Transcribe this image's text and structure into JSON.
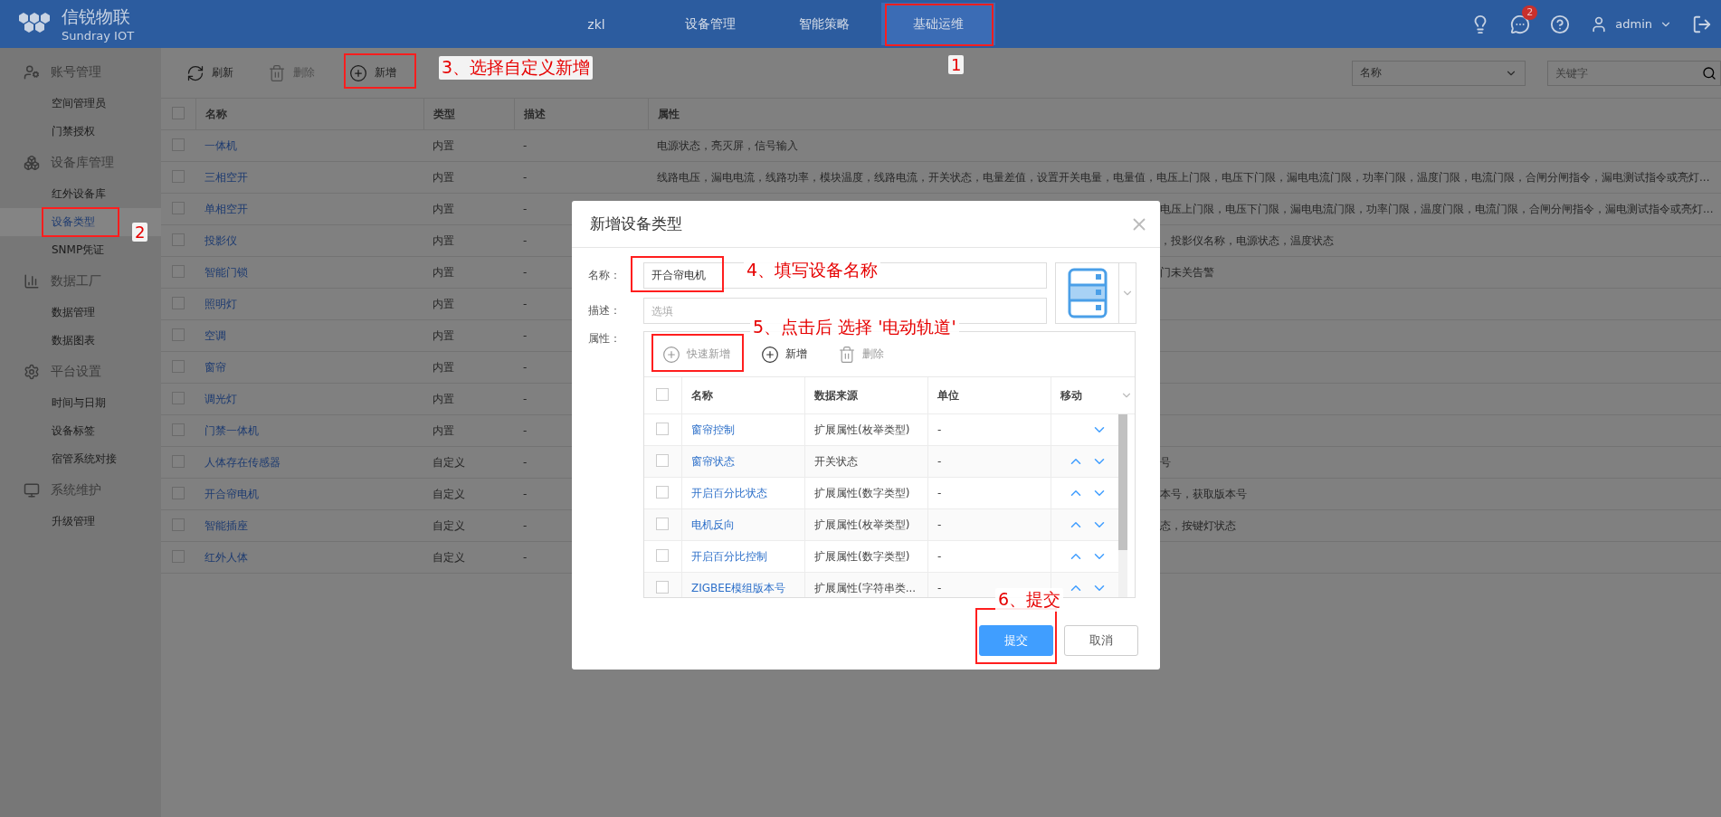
{
  "header": {
    "logo_title": "信锐物联",
    "logo_subtitle": "Sundray IOT",
    "notification_count": "2",
    "user": "admin",
    "nav": [
      {
        "label": "zkl",
        "selected": false
      },
      {
        "label": "设备管理",
        "selected": false
      },
      {
        "label": "智能策略",
        "selected": false
      },
      {
        "label": "基础运维",
        "selected": true
      }
    ]
  },
  "sidebar": {
    "groups": [
      {
        "title": "账号管理",
        "items": [
          {
            "label": "空间管理员",
            "selected": false
          },
          {
            "label": "门禁授权",
            "selected": false
          }
        ]
      },
      {
        "title": "设备库管理",
        "items": [
          {
            "label": "红外设备库",
            "selected": false
          },
          {
            "label": "设备类型",
            "selected": true
          },
          {
            "label": "SNMP凭证",
            "selected": false
          }
        ]
      },
      {
        "title": "数据工厂",
        "items": [
          {
            "label": "数据管理",
            "selected": false
          },
          {
            "label": "数据图表",
            "selected": false
          }
        ]
      },
      {
        "title": "平台设置",
        "items": [
          {
            "label": "时间与日期",
            "selected": false
          },
          {
            "label": "设备标签",
            "selected": false
          },
          {
            "label": "宿管系统对接",
            "selected": false
          }
        ]
      },
      {
        "title": "系统维护",
        "items": [
          {
            "label": "升级管理",
            "selected": false
          }
        ]
      }
    ]
  },
  "toolbar": {
    "buttons": [
      {
        "label": "刷新",
        "kind": "refresh",
        "disabled": false
      },
      {
        "label": "删除",
        "kind": "delete",
        "disabled": true
      },
      {
        "label": "新增",
        "kind": "add",
        "disabled": false
      }
    ],
    "filter_select": "名称",
    "search": {
      "placeholder": "关键字"
    }
  },
  "table": {
    "columns": [
      "名称",
      "类型",
      "描述",
      "属性"
    ],
    "all_checked": false,
    "rows": [
      {
        "checked": false,
        "name": "一体机",
        "type": "内置",
        "description": "-",
        "attributes": "电源状态，亮灭屏，信号输入"
      },
      {
        "checked": false,
        "name": "三相空开",
        "type": "内置",
        "description": "-",
        "attributes": "线路电压，漏电电流，线路功率，模块温度，线路电流，开关状态，电量差值，设置开关电量，电量值，电压上门限，电压下门限，漏电电流门限，功率门限，温度门限，电流门限，合闸分闸指令，漏电测试指令或亮灯..."
      },
      {
        "checked": false,
        "name": "单相空开",
        "type": "内置",
        "description": "-",
        "attributes": "电压上门限，电压下门限，漏电电流门限，功率门限，温度门限，电流门限，合闸分闸指令，漏电测试指令或亮灯...",
        "covered": true
      },
      {
        "checked": false,
        "name": "投影仪",
        "type": "内置",
        "description": "-",
        "attributes": "，投影仪名称，电源状态，温度状态",
        "covered": true
      },
      {
        "checked": false,
        "name": "智能门锁",
        "type": "内置",
        "description": "-",
        "attributes": "门未关告警",
        "covered": true
      },
      {
        "checked": false,
        "name": "照明灯",
        "type": "内置",
        "description": "-"
      },
      {
        "checked": false,
        "name": "空调",
        "type": "内置",
        "description": "-"
      },
      {
        "checked": false,
        "name": "窗帘",
        "type": "内置",
        "description": "-"
      },
      {
        "checked": false,
        "name": "调光灯",
        "type": "内置",
        "description": "-"
      },
      {
        "checked": false,
        "name": "门禁一体机",
        "type": "内置",
        "description": "-"
      },
      {
        "checked": false,
        "name": "人体存在传感器",
        "type": "自定义",
        "description": "-",
        "attributes": "号",
        "covered": true
      },
      {
        "checked": false,
        "name": "开合帘电机",
        "type": "自定义",
        "description": "-",
        "attributes": "本号，获取版本号",
        "covered": true
      },
      {
        "checked": false,
        "name": "智能插座",
        "type": "自定义",
        "description": "-",
        "attributes": "态，按键灯状态",
        "covered": true
      },
      {
        "checked": false,
        "name": "红外人体",
        "type": "自定义",
        "description": "-"
      }
    ]
  },
  "dialog": {
    "title": "新增设备类型",
    "fields": [
      {
        "label": "名称：",
        "value": "开合帘电机"
      },
      {
        "label": "描述：",
        "placeholder": "选填"
      }
    ],
    "attributes_label": "属性：",
    "attr_toolbar": [
      {
        "label": "快速新增",
        "kind": "add",
        "disabled": true
      },
      {
        "label": "新增",
        "kind": "add",
        "disabled": false
      },
      {
        "label": "删除",
        "kind": "delete",
        "disabled": true
      }
    ],
    "attr_table": {
      "columns": [
        "名称",
        "数据来源",
        "单位",
        "移动"
      ],
      "all_checked": false,
      "rows": [
        {
          "checked": false,
          "name": "窗帘控制",
          "source": "扩展属性(枚举类型)",
          "unit": "-",
          "can_up": false,
          "can_down": true
        },
        {
          "checked": false,
          "name": "窗帘状态",
          "source": "开关状态",
          "unit": "-",
          "can_up": true,
          "can_down": true
        },
        {
          "checked": false,
          "name": "开启百分比状态",
          "source": "扩展属性(数字类型)",
          "unit": "-",
          "can_up": true,
          "can_down": true
        },
        {
          "checked": false,
          "name": "电机反向",
          "source": "扩展属性(枚举类型)",
          "unit": "-",
          "can_up": true,
          "can_down": true
        },
        {
          "checked": false,
          "name": "开启百分比控制",
          "source": "扩展属性(数字类型)",
          "unit": "-",
          "can_up": true,
          "can_down": true
        },
        {
          "checked": false,
          "name": "ZIGBEE模组版本号",
          "source": "扩展属性(字符串类...",
          "unit": "-",
          "can_up": true,
          "can_down": true
        }
      ]
    },
    "buttons": [
      {
        "label": "提交",
        "primary": true
      },
      {
        "label": "取消",
        "primary": false
      }
    ]
  },
  "annotations": [
    {
      "kind": "frame"
    },
    {
      "kind": "label",
      "text": "1"
    },
    {
      "kind": "frame"
    },
    {
      "kind": "label",
      "text": "2"
    },
    {
      "kind": "frame"
    },
    {
      "kind": "label",
      "text": "3、选择自定义新增"
    },
    {
      "kind": "frame"
    },
    {
      "kind": "label",
      "text": "4、填写设备名称"
    },
    {
      "kind": "frame"
    },
    {
      "kind": "label",
      "text": "5、点击后 选择 '电动轨道'"
    },
    {
      "kind": "frame"
    },
    {
      "kind": "label",
      "text": "6、提交"
    }
  ]
}
